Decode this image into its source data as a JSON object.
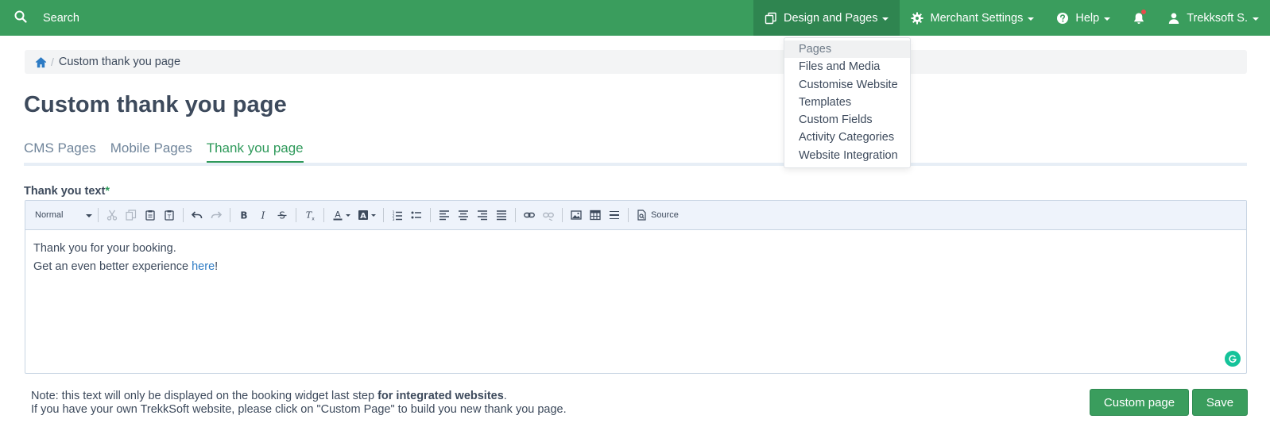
{
  "colors": {
    "navbar": "#3a9d5d",
    "navbar_active": "#2f8550",
    "accent": "#2f9a5b",
    "link": "#2d7bc4",
    "notification_dot": "#e74c4c",
    "grammarly": "#15c39a"
  },
  "topbar": {
    "search_label": "Search",
    "nav": [
      {
        "label": "Design and Pages",
        "icon": "copy-icon"
      },
      {
        "label": "Merchant Settings",
        "icon": "gear-icon"
      },
      {
        "label": "Help",
        "icon": "question-circle-icon"
      },
      {
        "label": "Trekksoft S.",
        "icon": "user-icon"
      }
    ]
  },
  "dropdown": {
    "items": [
      "Pages",
      "Files and Media",
      "Customise Website",
      "Templates",
      "Custom Fields",
      "Activity Categories",
      "Website Integration"
    ]
  },
  "breadcrumb": {
    "separator": "/",
    "current": "Custom thank you page"
  },
  "page": {
    "title": "Custom thank you page"
  },
  "tabs": [
    {
      "label": "CMS Pages"
    },
    {
      "label": "Mobile Pages"
    },
    {
      "label": "Thank you page",
      "active": true
    }
  ],
  "field": {
    "label": "Thank you text",
    "required_mark": "*"
  },
  "editor": {
    "format_select": "Normal",
    "source_label": "Source",
    "line1": "Thank you for your booking.",
    "line2_prefix": "Get an even better experience ",
    "line2_link": "here",
    "line2_suffix": "!"
  },
  "footer": {
    "note_prefix": "Note: this text will only be displayed on the booking widget last step ",
    "note_bold": "for integrated websites",
    "note_suffix": ".",
    "note_line2": "If you have your own TrekkSoft website, please click on \"Custom Page\" to build you new thank you page.",
    "custom_button": "Custom page",
    "save_button": "Save"
  }
}
